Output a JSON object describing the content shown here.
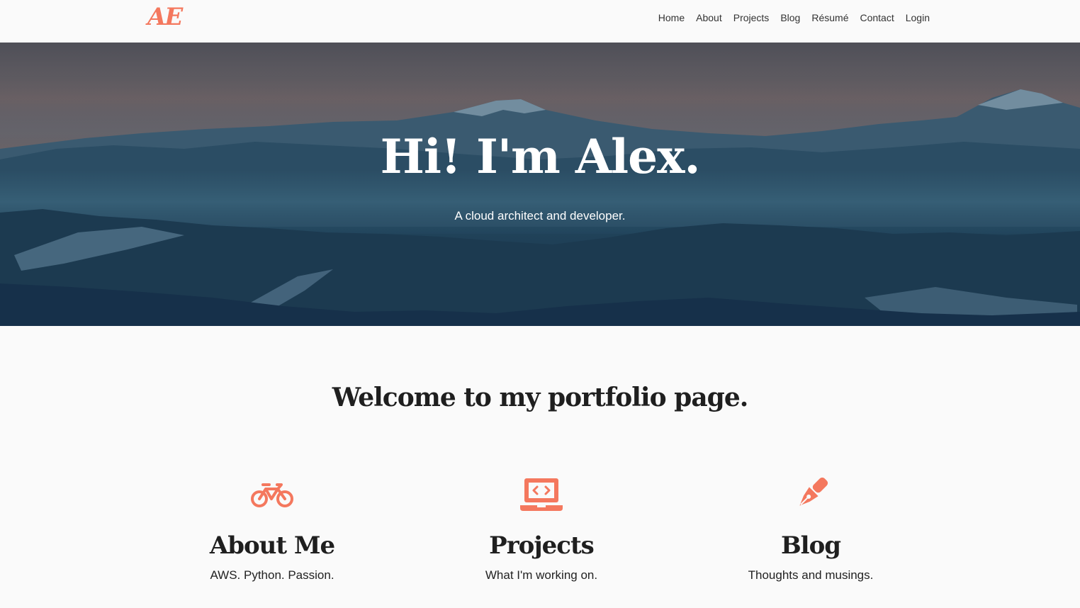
{
  "nav": {
    "logo": "AE",
    "links": [
      "Home",
      "About",
      "Projects",
      "Blog",
      "Résumé",
      "Contact",
      "Login"
    ]
  },
  "hero": {
    "title": "Hi! I'm Alex.",
    "subtitle": "A cloud architect and developer."
  },
  "main": {
    "welcome": "Welcome to my portfolio page.",
    "features": [
      {
        "icon": "bicycle-icon",
        "title": "About Me",
        "description": "AWS. Python. Passion."
      },
      {
        "icon": "laptop-code-icon",
        "title": "Projects",
        "description": "What I'm working on."
      },
      {
        "icon": "pen-nib-icon",
        "title": "Blog",
        "description": "Thoughts and musings."
      }
    ]
  },
  "colors": {
    "accent": "#f4785e",
    "text": "#222222",
    "background": "#fafafa"
  }
}
